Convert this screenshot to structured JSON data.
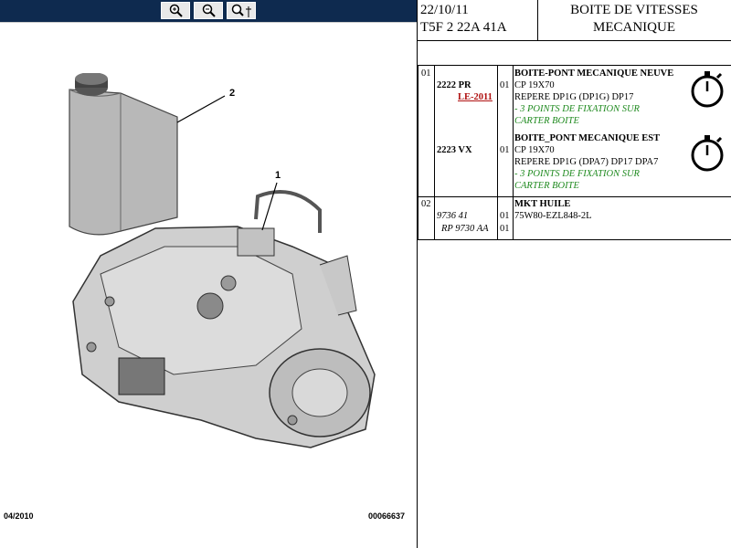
{
  "toolbar": {
    "zoom_in_icon": "zoom-in-icon",
    "zoom_out_icon": "zoom-out-icon",
    "zoom_fit_icon": "zoom-fit-icon"
  },
  "header": {
    "date": "22/10/11",
    "code": "T5F 2 22A 41A",
    "title_line1": "BOITE DE VITESSES",
    "title_line2": "MECANIQUE"
  },
  "rows": [
    {
      "ref": "01",
      "parts": [
        {
          "number": "2222 PR",
          "sub": "LE-2011",
          "qty": "01",
          "title": "BOITE-PONT MECANIQUE NEUVE",
          "lines": [
            "CP 19X70",
            "REPERE DP1G (DP1G) DP17"
          ],
          "notes": [
            "- 3 POINTS DE FIXATION SUR",
            "CARTER BOITE"
          ],
          "icon": "stopwatch-icon"
        },
        {
          "number": "2223 VX",
          "qty": "01",
          "title": "BOITE_PONT MECANIQUE EST",
          "lines": [
            "CP 19X70",
            "REPERE DP1G (DPA7) DP17 DPA7"
          ],
          "notes": [
            "- 3 POINTS DE FIXATION SUR",
            "CARTER BOITE"
          ],
          "icon": "stopwatch-icon"
        }
      ]
    },
    {
      "ref": "02",
      "parts": [
        {
          "number": "9736 41",
          "qty": "01",
          "title": "MKT HUILE",
          "lines": [
            "75W80-EZL848-2L"
          ]
        },
        {
          "number": "RP 9730 AA",
          "qty": "01"
        }
      ]
    }
  ],
  "drawing": {
    "label_1": "1",
    "label_2": "2",
    "footer_left": "04/2010",
    "footer_right": "00066637"
  }
}
